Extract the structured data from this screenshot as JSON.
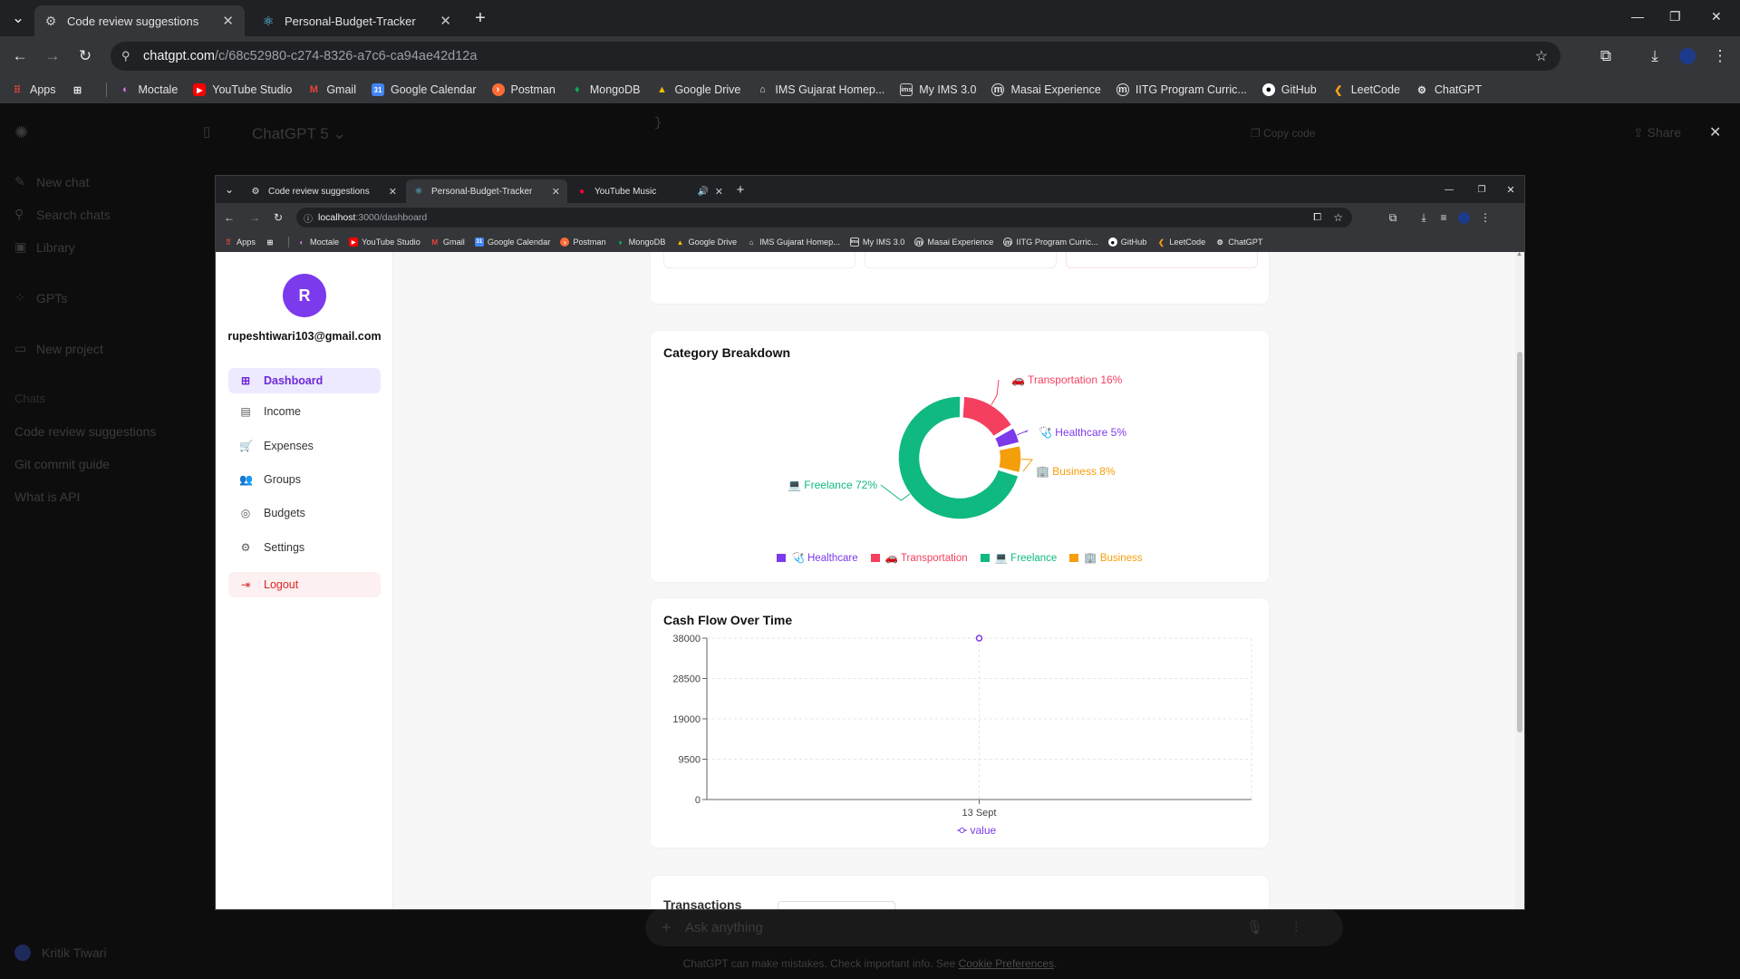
{
  "outer_browser": {
    "tabs": [
      {
        "title": "Code review suggestions",
        "active": true
      },
      {
        "title": "Personal-Budget-Tracker",
        "active": false
      }
    ],
    "url_host": "chatgpt.com",
    "url_path": "/c/68c52980-c274-8326-a7c6-ca94ae42d12a",
    "bookmarks": [
      "Apps",
      "Moctale",
      "YouTube Studio",
      "Gmail",
      "Google Calendar",
      "Postman",
      "MongoDB",
      "Google Drive",
      "IMS Gujarat Homep...",
      "My IMS 3.0",
      "Masai Experience",
      "IITG Program Curric...",
      "GitHub",
      "LeetCode",
      "ChatGPT"
    ]
  },
  "chatgpt": {
    "model": "ChatGPT 5",
    "new_chat": "New chat",
    "search_chats": "Search chats",
    "library": "Library",
    "gpts": "GPTs",
    "new_project": "New project",
    "chats_label": "Chats",
    "chats": [
      "Code review suggestions",
      "Git commit guide",
      "What is API"
    ],
    "user": "Kritik Tiwari",
    "share": "Share",
    "copy_code": "Copy code",
    "code_brace": "}",
    "ask_placeholder": "Ask anything",
    "disclaimer": "ChatGPT can make mistakes. Check important info. See ",
    "disclaimer_link": "Cookie Preferences",
    "disclaimer_end": "."
  },
  "inner_browser": {
    "tabs": [
      {
        "title": "Code review suggestions",
        "active": false
      },
      {
        "title": "Personal-Budget-Tracker",
        "active": true
      },
      {
        "title": "YouTube Music",
        "active": false
      }
    ],
    "url_host": "localhost",
    "url_path": ":3000/dashboard",
    "bookmarks": [
      "Apps",
      "Moctale",
      "YouTube Studio",
      "Gmail",
      "Google Calendar",
      "Postman",
      "MongoDB",
      "Google Drive",
      "IMS Gujarat Homep...",
      "My IMS 3.0",
      "Masai Experience",
      "IITG Program Curric...",
      "GitHub",
      "LeetCode",
      "ChatGPT"
    ]
  },
  "app": {
    "avatar_letter": "R",
    "email": "rupeshtiwari103@gmail.com",
    "nav": [
      {
        "label": "Dashboard",
        "icon": "dashboard-icon",
        "active": true
      },
      {
        "label": "Income",
        "icon": "wallet-icon",
        "active": false
      },
      {
        "label": "Expenses",
        "icon": "cart-icon",
        "active": false
      },
      {
        "label": "Groups",
        "icon": "users-icon",
        "active": false
      },
      {
        "label": "Budgets",
        "icon": "target-icon",
        "active": false
      },
      {
        "label": "Settings",
        "icon": "gear-icon",
        "active": false
      }
    ],
    "logout": "Logout"
  },
  "chart_data": [
    {
      "type": "pie",
      "title": "Category Breakdown",
      "slices": [
        {
          "name": "Transportation",
          "value": 16,
          "label": "Transportation 16%",
          "color": "#f43f5e",
          "emoji": "🚗"
        },
        {
          "name": "Healthcare",
          "value": 5,
          "label": "Healthcare 5%",
          "color": "#7c3aed",
          "emoji": "🩺"
        },
        {
          "name": "Business",
          "value": 8,
          "label": "Business 8%",
          "color": "#f59e0b",
          "emoji": "🏢"
        },
        {
          "name": "Freelance",
          "value": 72,
          "label": "Freelance 72%",
          "color": "#10b981",
          "emoji": "💻"
        }
      ],
      "legend": [
        {
          "name": "Healthcare",
          "emoji": "🩺",
          "color": "#7c3aed"
        },
        {
          "name": "Transportation",
          "emoji": "🚗",
          "color": "#f43f5e"
        },
        {
          "name": "Freelance",
          "emoji": "💻",
          "color": "#10b981"
        },
        {
          "name": "Business",
          "emoji": "🏢",
          "color": "#f59e0b"
        }
      ],
      "legend_placement": "bottom"
    },
    {
      "type": "line",
      "title": "Cash Flow Over Time",
      "x": [
        "13 Sept"
      ],
      "series": [
        {
          "name": "value",
          "values": [
            38000
          ],
          "color": "#7c3aed"
        }
      ],
      "yticks": [
        0,
        9500,
        19000,
        28500,
        38000
      ],
      "ylim": [
        0,
        38000
      ],
      "grid": true,
      "legend_placement": "bottom"
    }
  ],
  "transactions_card": {
    "title": "Transactions"
  }
}
